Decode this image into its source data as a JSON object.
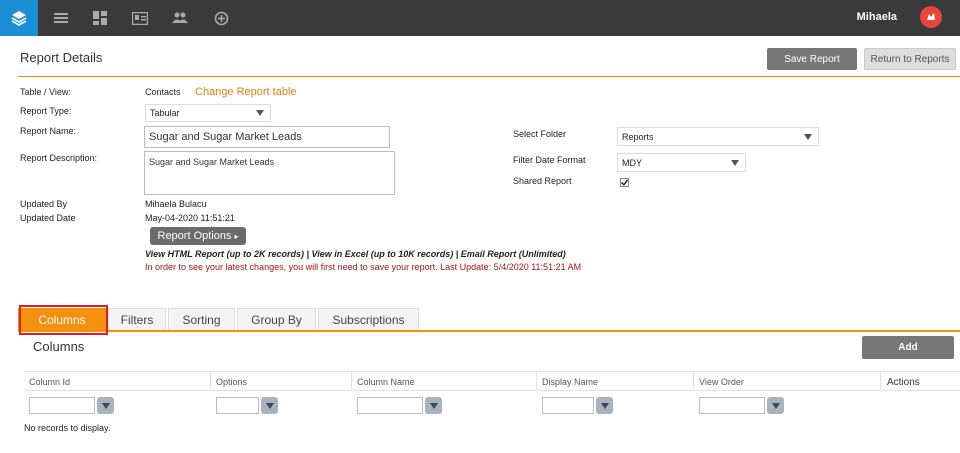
{
  "topbar": {
    "icons": [
      "layers-icon",
      "menu-icon",
      "dashboard-icon",
      "contact-card-icon",
      "users-icon",
      "add-circle-icon"
    ],
    "user_name": "Mihaela"
  },
  "header": {
    "title": "Report Details",
    "save_label": "Save Report",
    "return_label": "Return to Reports"
  },
  "form": {
    "table_label": "Table / View:",
    "table_value": "Contacts",
    "change_table_link": "Change Report table",
    "type_label": "Report Type:",
    "type_value": "Tabular",
    "name_label": "Report Name:",
    "name_value": "Sugar and Sugar Market Leads",
    "description_label": "Report Description:",
    "description_value": "Sugar and Sugar Market Leads",
    "folder_label": "Select Folder",
    "folder_value": "Reports",
    "date_format_label": "Filter Date Format",
    "date_format_value": "MDY",
    "shared_label": "Shared Report",
    "shared_checked": true,
    "updated_by_label": "Updated By",
    "updated_by_value": "Mihaela Bulacu",
    "updated_date_label": "Updated Date",
    "updated_date_value": "May-04-2020 11:51:21",
    "options_button": "Report Options",
    "report_links": "View HTML Report (up to 2K records) | View in Excel (up to 10K records) | Email Report (Unlimited)",
    "warning": "In order to see your latest changes, you will first need to save your report. Last Update: 5/4/2020 11:51:21 AM"
  },
  "tabs": [
    {
      "label": "Columns",
      "active": true
    },
    {
      "label": "Filters",
      "active": false
    },
    {
      "label": "Sorting",
      "active": false
    },
    {
      "label": "Group By",
      "active": false
    },
    {
      "label": "Subscriptions",
      "active": false
    }
  ],
  "columns_section": {
    "title": "Columns",
    "add_label": "Add",
    "headers": [
      "Column Id",
      "Options",
      "Column Name",
      "Display Name",
      "View Order",
      "Actions"
    ],
    "empty_message": "No records to display."
  },
  "colors": {
    "topbar": "#3a3a3a",
    "brand_blue": "#1b8fd6",
    "accent_orange": "#f4900f",
    "avatar_red": "#e8463a",
    "warning_red": "#a31515"
  }
}
